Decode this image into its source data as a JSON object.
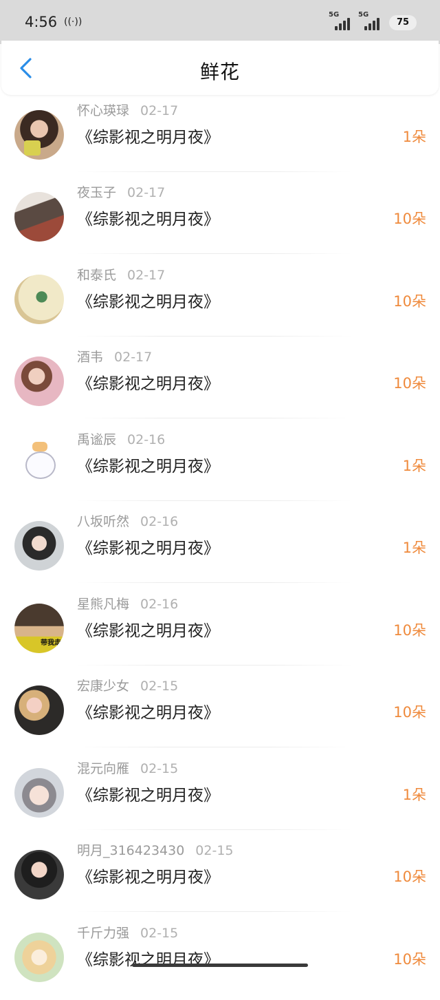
{
  "status": {
    "time": "4:56",
    "nfc": "((·))",
    "sim1": "5G",
    "sim2": "5G",
    "battery": "75"
  },
  "header": {
    "title": "鲜花"
  },
  "colors": {
    "accent": "#2a8de8",
    "count": "#ef8a3c",
    "username": "#9a9a9a",
    "statusbar": "#dadada"
  },
  "items": [
    {
      "user": "怀心瑛琭",
      "date": "02-17",
      "book": "《综影视之明月夜》",
      "count": "1朵"
    },
    {
      "user": "夜玉子",
      "date": "02-17",
      "book": "《综影视之明月夜》",
      "count": "10朵"
    },
    {
      "user": "和泰氏",
      "date": "02-17",
      "book": "《综影视之明月夜》",
      "count": "10朵"
    },
    {
      "user": "酒韦",
      "date": "02-17",
      "book": "《综影视之明月夜》",
      "count": "10朵"
    },
    {
      "user": "禹谧辰",
      "date": "02-16",
      "book": "《综影视之明月夜》",
      "count": "1朵"
    },
    {
      "user": "八坂听然",
      "date": "02-16",
      "book": "《综影视之明月夜》",
      "count": "1朵"
    },
    {
      "user": "星熊凡梅",
      "date": "02-16",
      "book": "《综影视之明月夜》",
      "count": "10朵",
      "avatar_text": "带我走"
    },
    {
      "user": "宏康少女",
      "date": "02-15",
      "book": "《综影视之明月夜》",
      "count": "10朵"
    },
    {
      "user": "混元向雁",
      "date": "02-15",
      "book": "《综影视之明月夜》",
      "count": "1朵"
    },
    {
      "user": "明月_316423430",
      "date": "02-15",
      "book": "《综影视之明月夜》",
      "count": "10朵"
    },
    {
      "user": "千斤力强",
      "date": "02-15",
      "book": "《综影视之明月夜》",
      "count": "10朵"
    }
  ]
}
